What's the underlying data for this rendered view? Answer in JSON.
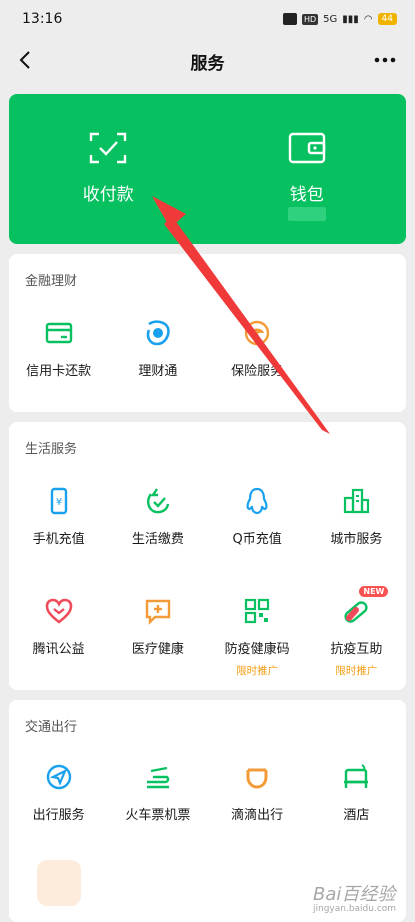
{
  "status": {
    "time": "13:16",
    "network": "5G",
    "battery": "44"
  },
  "nav": {
    "title": "服务"
  },
  "wallet": {
    "receive_pay": "收付款",
    "wallet": "钱包"
  },
  "finance": {
    "title": "金融理财",
    "items": [
      {
        "label": "信用卡还款",
        "icon": "credit-card-icon"
      },
      {
        "label": "理财通",
        "icon": "wealth-icon"
      },
      {
        "label": "保险服务",
        "icon": "insurance-umbrella-icon"
      }
    ]
  },
  "life": {
    "title": "生活服务",
    "items": [
      {
        "label": "手机充值",
        "icon": "phone-topup-icon"
      },
      {
        "label": "生活缴费",
        "icon": "bill-pay-icon"
      },
      {
        "label": "Q币充值",
        "icon": "qq-penguin-icon"
      },
      {
        "label": "城市服务",
        "icon": "city-buildings-icon"
      },
      {
        "label": "腾讯公益",
        "icon": "charity-heart-icon"
      },
      {
        "label": "医疗健康",
        "icon": "medical-plus-icon"
      },
      {
        "label": "防疫健康码",
        "sub": "限时推广",
        "icon": "qr-code-icon"
      },
      {
        "label": "抗疫互助",
        "sub": "限时推广",
        "badge": "NEW",
        "icon": "pill-icon"
      }
    ]
  },
  "transport": {
    "title": "交通出行",
    "items": [
      {
        "label": "出行服务",
        "icon": "navigation-arrow-icon"
      },
      {
        "label": "火车票机票",
        "icon": "train-plane-icon"
      },
      {
        "label": "滴滴出行",
        "icon": "didi-icon"
      },
      {
        "label": "酒店",
        "icon": "hotel-bed-icon"
      }
    ]
  },
  "watermark": {
    "text": "Bai百经验",
    "sub": "jingyan.baidu.com"
  },
  "colors": {
    "primary": "#07c160",
    "tag": "#f39c12",
    "badge": "#fa5151",
    "arrow": "#f03a3a"
  }
}
